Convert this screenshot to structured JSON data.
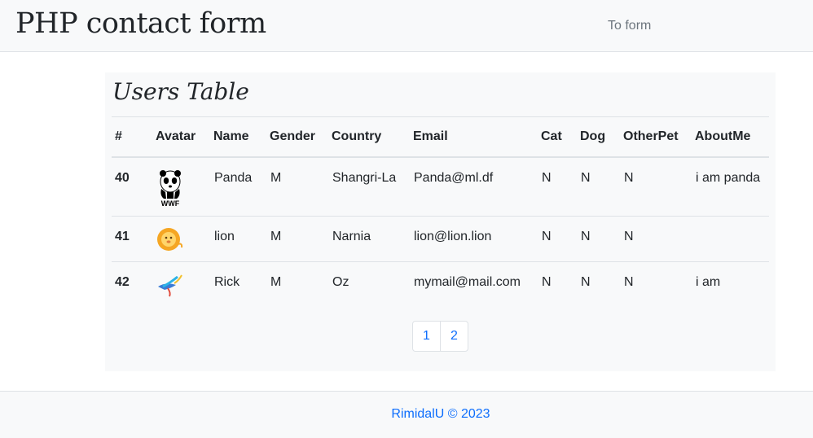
{
  "navbar": {
    "brand": "PHP contact form",
    "link": "To form"
  },
  "panel": {
    "title": "Users Table"
  },
  "table": {
    "headers": [
      "#",
      "Avatar",
      "Name",
      "Gender",
      "Country",
      "Email",
      "Cat",
      "Dog",
      "OtherPet",
      "AboutMe"
    ],
    "rows": [
      {
        "id": "40",
        "avatar": "panda-wwf-icon",
        "name": "Panda",
        "gender": "M",
        "country": "Shangri-La",
        "email": "Panda@ml.df",
        "cat": "N",
        "dog": "N",
        "other": "N",
        "about": "i am panda"
      },
      {
        "id": "41",
        "avatar": "lion-icon",
        "name": "lion",
        "gender": "M",
        "country": "Narnia",
        "email": "lion@lion.lion",
        "cat": "N",
        "dog": "N",
        "other": "N",
        "about": ""
      },
      {
        "id": "42",
        "avatar": "bird-icon",
        "name": "Rick",
        "gender": "M",
        "country": "Oz",
        "email": "mymail@mail.com",
        "cat": "N",
        "dog": "N",
        "other": "N",
        "about": "i am"
      }
    ]
  },
  "pagination": {
    "pages": [
      "1",
      "2"
    ]
  },
  "footer": {
    "text": "RimidalU © 2023"
  },
  "colors": {
    "accent": "#0d6efd",
    "panel_bg": "#f8f9fa",
    "border": "#dee2e6"
  }
}
